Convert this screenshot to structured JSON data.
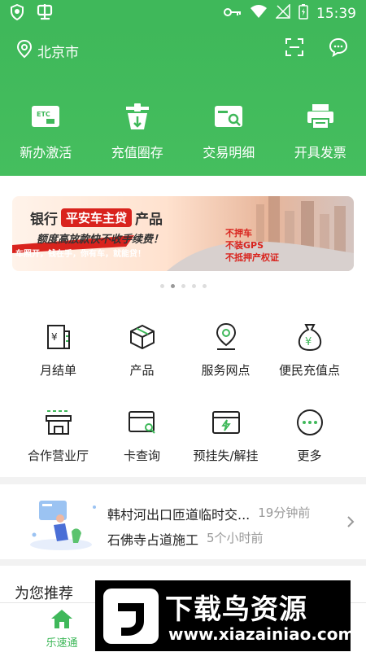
{
  "status_bar": {
    "time": "15:39"
  },
  "header": {
    "location": "北京市",
    "quick_actions": [
      {
        "label": "新办激活",
        "icon": "etc-card-icon"
      },
      {
        "label": "充值圈存",
        "icon": "recharge-station-icon"
      },
      {
        "label": "交易明细",
        "icon": "transaction-search-icon"
      },
      {
        "label": "开具发票",
        "icon": "printer-icon"
      }
    ]
  },
  "banner": {
    "bank_text": "银行",
    "product_badge": "平安车主贷",
    "product_suffix": "产品",
    "tagline": "额度高放款快不收手续费！",
    "slogan": "车照开，钱在手，你有车，就能贷！",
    "features": [
      "不押车",
      "不装GPS",
      "不抵押产权证"
    ],
    "active_dot_index": 1,
    "dot_count": 5
  },
  "services": [
    {
      "label": "月结单",
      "icon": "statement-icon"
    },
    {
      "label": "产品",
      "icon": "box-icon"
    },
    {
      "label": "服务网点",
      "icon": "location-pin-icon"
    },
    {
      "label": "便民充值点",
      "icon": "yen-bag-icon"
    },
    {
      "label": "合作营业厅",
      "icon": "store-icon"
    },
    {
      "label": "卡查询",
      "icon": "card-search-icon"
    },
    {
      "label": "预挂失/解挂",
      "icon": "card-flash-icon"
    },
    {
      "label": "更多",
      "icon": "more-icon"
    }
  ],
  "news": [
    {
      "title": "韩村河出口匝道临时交...",
      "time": "19分钟前"
    },
    {
      "title": "石佛寺占道施工",
      "time": "5个小时前"
    }
  ],
  "recommend": {
    "title": "为您推荐"
  },
  "tabbar": {
    "tabs": [
      {
        "label": "乐速通",
        "active": true
      }
    ]
  },
  "watermark": {
    "text": "下载鸟资源",
    "url": "www.xiazainiao.com"
  },
  "colors": {
    "brand_green": "#3fb85a",
    "banner_red": "#d9231d"
  }
}
